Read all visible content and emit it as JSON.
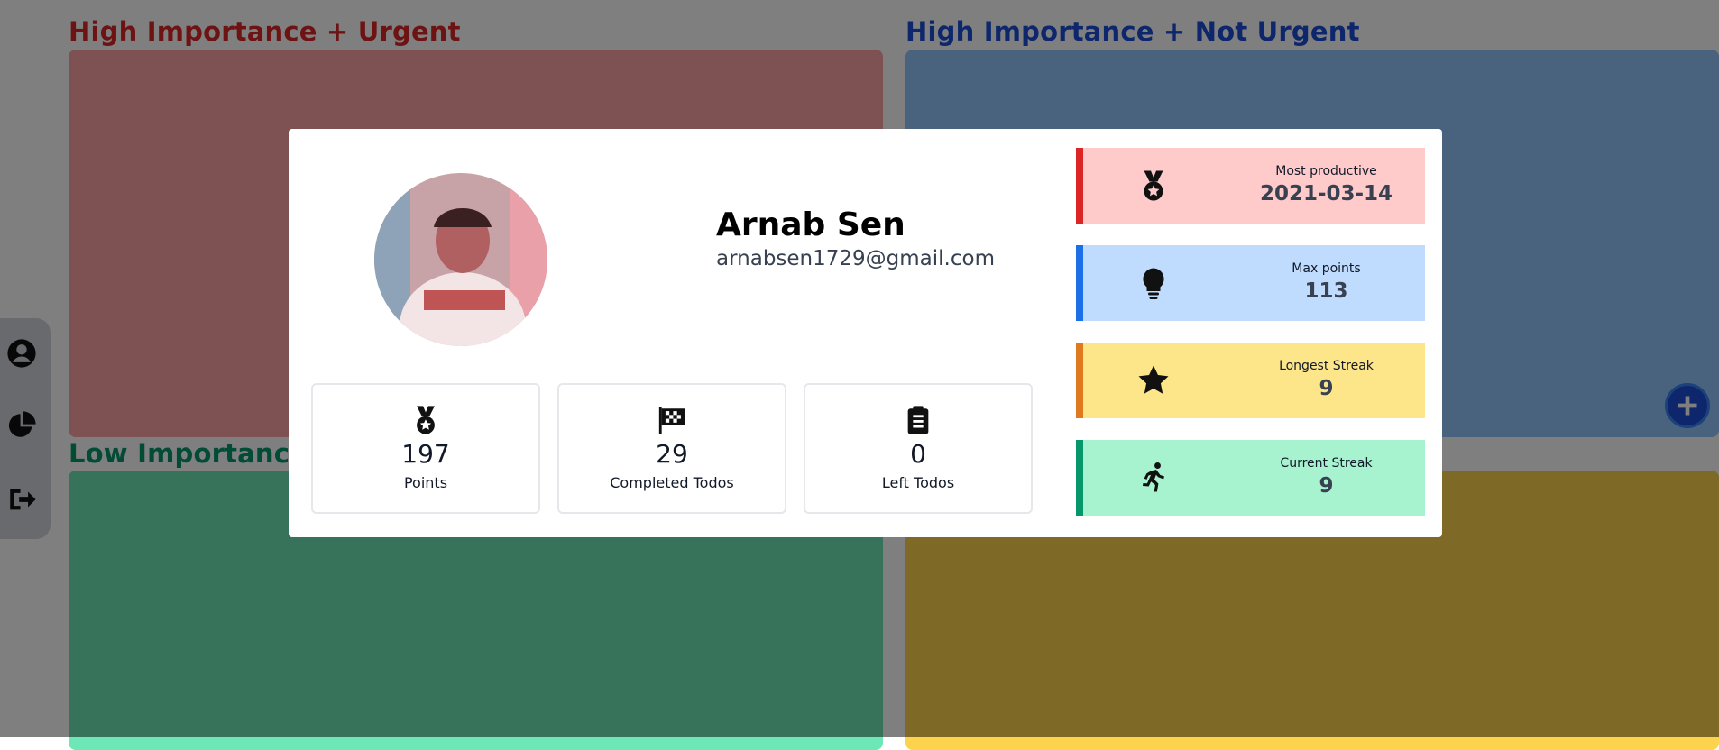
{
  "quadrants": {
    "q1_title": "High Importance + Urgent",
    "q2_title": "High Importance + Not Urgent",
    "q3_title": "Low Importance + Urgent",
    "colors": {
      "q1": "#fca5a5",
      "q2": "#93c5fd",
      "q3": "#6ee7b7",
      "q4": "#fcd34d"
    }
  },
  "sidebar": {
    "items": [
      "user-circle-icon",
      "pie-chart-icon",
      "logout-icon"
    ]
  },
  "add_button": {
    "icon": "plus-icon"
  },
  "profile": {
    "name": "Arnab Sen",
    "email": "arnabsen1729@gmail.com",
    "stats": [
      {
        "icon": "medal-icon",
        "value": "197",
        "label": "Points"
      },
      {
        "icon": "checkered-flag-icon",
        "value": "29",
        "label": "Completed Todos"
      },
      {
        "icon": "clipboard-list-icon",
        "value": "0",
        "label": "Left Todos"
      }
    ],
    "side_stats": [
      {
        "icon": "medal-icon",
        "label": "Most productive",
        "value": "2021-03-14",
        "bg": "#fecaca",
        "accent": "#dc2626"
      },
      {
        "icon": "lightbulb-icon",
        "label": "Max points",
        "value": "113",
        "bg": "#bfdbfe",
        "accent": "#1d6fe8"
      },
      {
        "icon": "star-icon",
        "label": "Longest Streak",
        "value": "9",
        "bg": "#fde68a",
        "accent": "#e07a1f"
      },
      {
        "icon": "running-icon",
        "label": "Current Streak",
        "value": "9",
        "bg": "#a7f3d0",
        "accent": "#059669"
      }
    ]
  }
}
